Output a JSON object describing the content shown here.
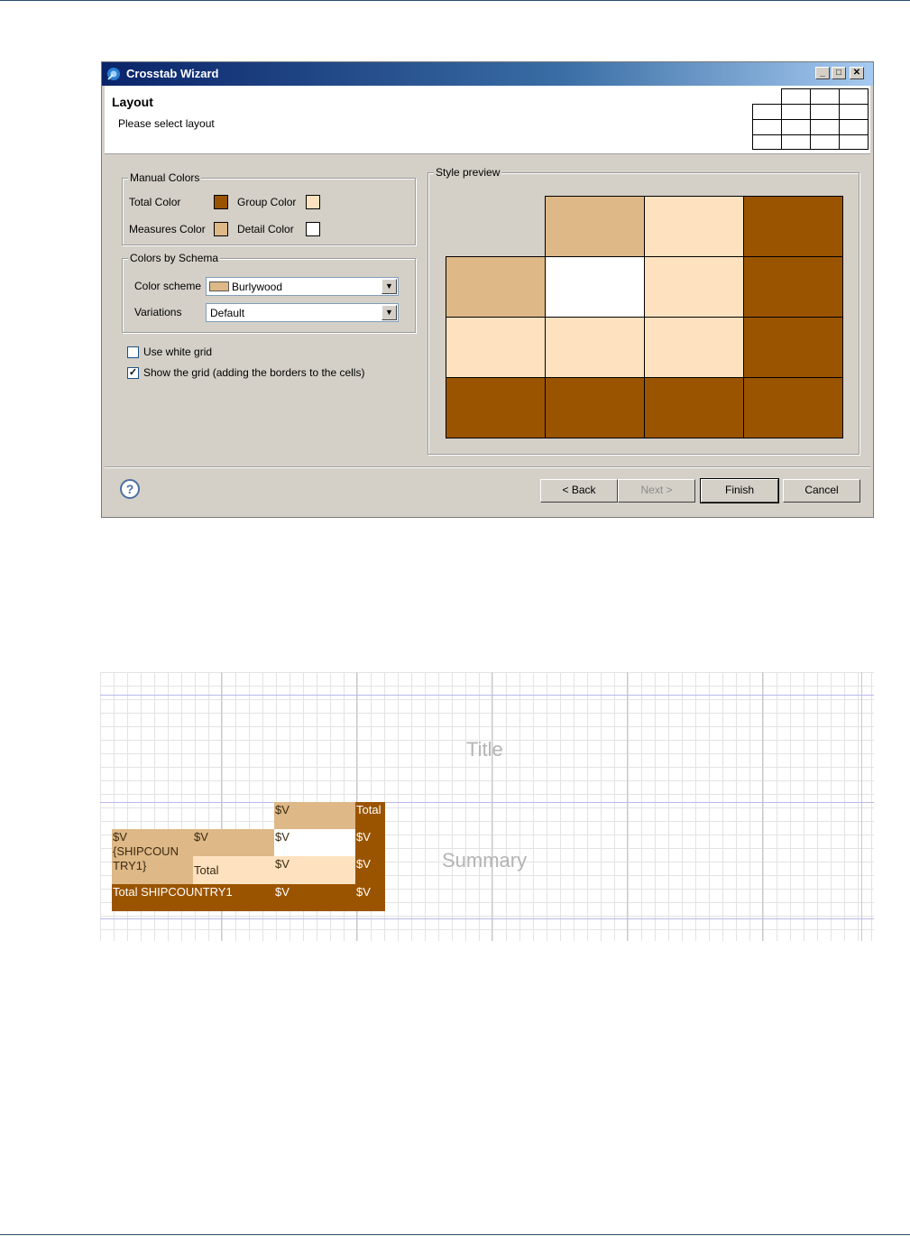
{
  "window": {
    "title": "Crosstab Wizard",
    "controls": {
      "minimize": "_",
      "maximize": "□",
      "close": "✕"
    }
  },
  "header": {
    "title": "Layout",
    "description": "Please select layout"
  },
  "manual_colors": {
    "legend": "Manual Colors",
    "total_label": "Total Color",
    "total_color": "#9a5400",
    "group_label": "Group Color",
    "group_color": "#fee2c0",
    "measures_label": "Measures Color",
    "measures_color": "#deb887",
    "detail_label": "Detail Color",
    "detail_color": "#ffffff"
  },
  "colors_by_schema": {
    "legend": "Colors by Schema",
    "scheme_label": "Color scheme",
    "scheme_value": "Burlywood",
    "variations_label": "Variations",
    "variations_value": "Default"
  },
  "options": {
    "white_grid_label": "Use white grid",
    "white_grid_checked": false,
    "show_grid_label": "Show the grid (adding the borders to the cells)",
    "show_grid_checked": true
  },
  "style_preview": {
    "legend": "Style preview",
    "rows": [
      [
        "",
        "#deb887",
        "#fee2c0",
        "#9a5400"
      ],
      [
        "#deb887",
        "#ffffff",
        "#fee2c0",
        "#9a5400"
      ],
      [
        "#fee2c0",
        "#fee2c0",
        "#fee2c0",
        "#9a5400"
      ],
      [
        "#9a5400",
        "#9a5400",
        "#9a5400",
        "#9a5400"
      ]
    ]
  },
  "buttons": {
    "help": "?",
    "back": "< Back",
    "next": "Next >",
    "finish": "Finish",
    "cancel": "Cancel"
  },
  "designer": {
    "title_band": "Title",
    "summary_band": "Summary",
    "crosstab": {
      "col_header": "$V",
      "col_total": "Total",
      "row_group_header": "$V",
      "row_group_field": "{SHIPCOUNTRY1}",
      "row_group_field_line1": "{SHIPCOUN",
      "row_group_field_line2": "TRY1}",
      "row_header": "$V",
      "row_total": "Total",
      "measure": "$V",
      "grand_total_label": "Total SHIPCOUNTRY1"
    }
  }
}
